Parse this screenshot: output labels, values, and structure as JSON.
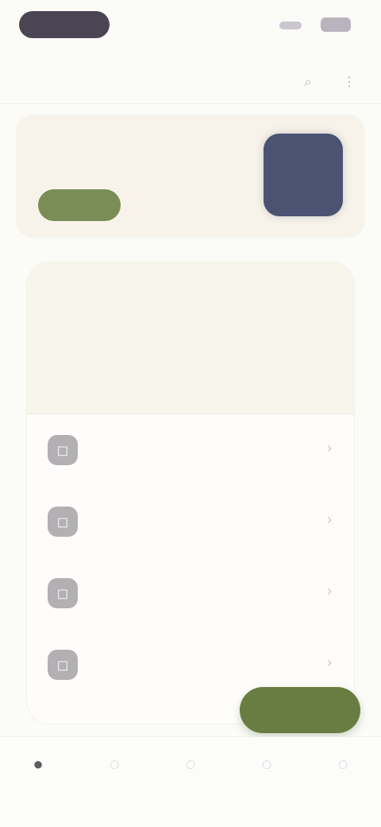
{
  "status_bar": {
    "time": "",
    "pill_color": "#4b4452",
    "signal_color": "#ccc6cf",
    "battery_color": "#b8b3bd"
  },
  "header": {
    "title": "",
    "search_icon": "search-icon",
    "more_icon": "more-icon"
  },
  "promo": {
    "title": "",
    "button_label": "",
    "art_color": "#4a5371",
    "background": "#f7f3ea"
  },
  "sheet": {
    "kicker": "",
    "heading": "",
    "subtitle": "",
    "items": [
      {
        "label": "",
        "icon": "item-1-icon"
      },
      {
        "label": "",
        "icon": "item-2-icon"
      },
      {
        "label": "",
        "icon": "item-3-icon"
      },
      {
        "label": "",
        "icon": "item-4-icon"
      }
    ]
  },
  "fab": {
    "label": "",
    "color": "#697d42"
  },
  "bottom_nav": {
    "items": [
      {
        "label": "",
        "icon": "home-icon",
        "active": true
      },
      {
        "label": "",
        "icon": "tab-2-icon",
        "active": false
      },
      {
        "label": "",
        "icon": "tab-3-icon",
        "active": false
      },
      {
        "label": "",
        "icon": "tab-4-icon",
        "active": false
      },
      {
        "label": "",
        "icon": "tab-5-icon",
        "active": false
      }
    ]
  },
  "accent_colors": {
    "primary_green": "#697d42",
    "promo_green": "#7a8d57",
    "hero_background": "#f8f5ec"
  }
}
